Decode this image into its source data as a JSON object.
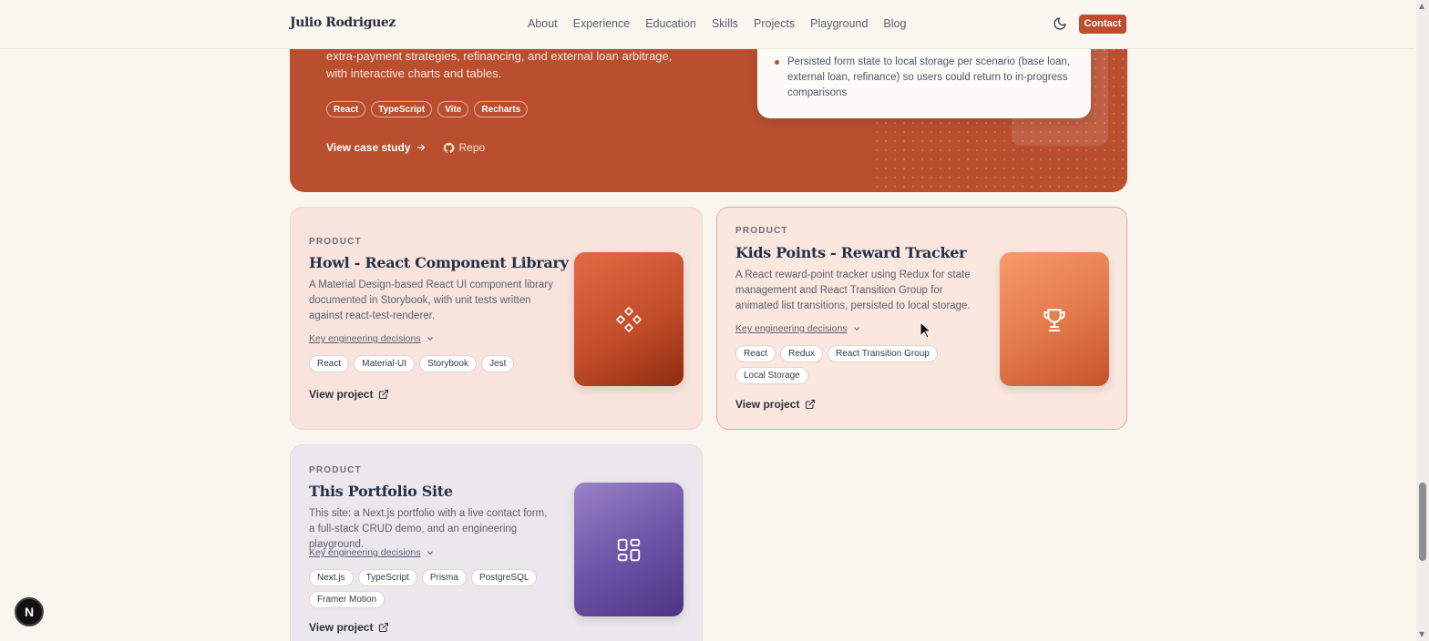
{
  "header": {
    "brand": "Julio Rodriguez",
    "nav": [
      "About",
      "Experience",
      "Education",
      "Skills",
      "Projects",
      "Playground",
      "Blog"
    ],
    "theme_icon": "moon-icon",
    "contact_label": "Contact"
  },
  "featured": {
    "description": "extra-payment strategies, refinancing, and external loan arbitrage, with interactive charts and tables.",
    "tags": [
      "React",
      "TypeScript",
      "Vite",
      "Recharts"
    ],
    "case_study_label": "View case study",
    "repo_label": "Repo",
    "panel_bullet": "Persisted form state to local storage per scenario (base loan, external loan, refinance) so users could return to in-progress comparisons"
  },
  "projects": [
    {
      "eyebrow": "PRODUCT",
      "title": "Howl - React Component Library",
      "description": "A Material Design-based React UI component library documented in Storybook, with unit tests written against react-test-renderer.",
      "decisions_label": "Key engineering decisions",
      "tags": [
        "React",
        "Material-UI",
        "Storybook",
        "Jest"
      ],
      "link_label": "View project",
      "icon": "diamond-cluster-icon",
      "accent": "#c44e2a"
    },
    {
      "eyebrow": "PRODUCT",
      "title": "Kids Points - Reward Tracker",
      "description": "A React reward-point tracker using Redux for state management and React Transition Group for animated list transitions, persisted to local storage.",
      "decisions_label": "Key engineering decisions",
      "tags": [
        "React",
        "Redux",
        "React Transition Group",
        "Local Storage"
      ],
      "link_label": "View project",
      "icon": "trophy-icon",
      "accent": "#e47c4d"
    },
    {
      "eyebrow": "PRODUCT",
      "title": "This Portfolio Site",
      "description": "This site: a Next.js portfolio with a live contact form, a full-stack CRUD demo, and an engineering playground.",
      "decisions_label": "Key engineering decisions",
      "tags": [
        "Next.js",
        "TypeScript",
        "Prisma",
        "PostgreSQL",
        "Framer Motion"
      ],
      "link_label": "View project",
      "icon": "layout-grid-icon",
      "accent": "#6f55a8"
    }
  ],
  "dev_badge": "N",
  "colors": {
    "brand": "#bf4e2e",
    "background": "#f9f6f0"
  }
}
